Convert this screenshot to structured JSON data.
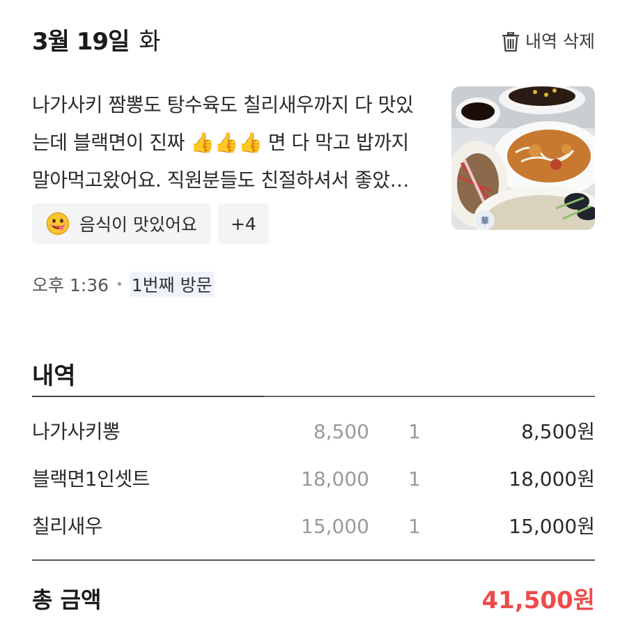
{
  "header": {
    "date_month_day": "3월 19일",
    "day_of_week": "화",
    "delete_label": "내역 삭제"
  },
  "review": {
    "text": "나가사키 짬뽕도 탕수육도 칠리새우까지 다 맛있는데 블랙면이 진짜 👍👍👍 면 다 막고 밥까지 말아먹고왔어요. 직원분들도 친절하셔서 좋았어요.",
    "tags": [
      {
        "icon": "smiling-face-icon",
        "label": "음식이 맛있어요"
      },
      {
        "label": "+4"
      }
    ]
  },
  "meta": {
    "time": "오후 1:36",
    "visit": "1번째 방문"
  },
  "receipt": {
    "title": "내역",
    "items": [
      {
        "name": "나가사키뽕",
        "price": "8,500",
        "qty": "1",
        "subtotal": "8,500원"
      },
      {
        "name": "블랙면1인셋트",
        "price": "18,000",
        "qty": "1",
        "subtotal": "18,000원"
      },
      {
        "name": "칠리새우",
        "price": "15,000",
        "qty": "1",
        "subtotal": "15,000원"
      }
    ],
    "total_label": "총 금액",
    "total_value": "41,500원"
  },
  "colors": {
    "total_accent": "#ee4b4b",
    "tag_bg": "#f4f4f5"
  }
}
